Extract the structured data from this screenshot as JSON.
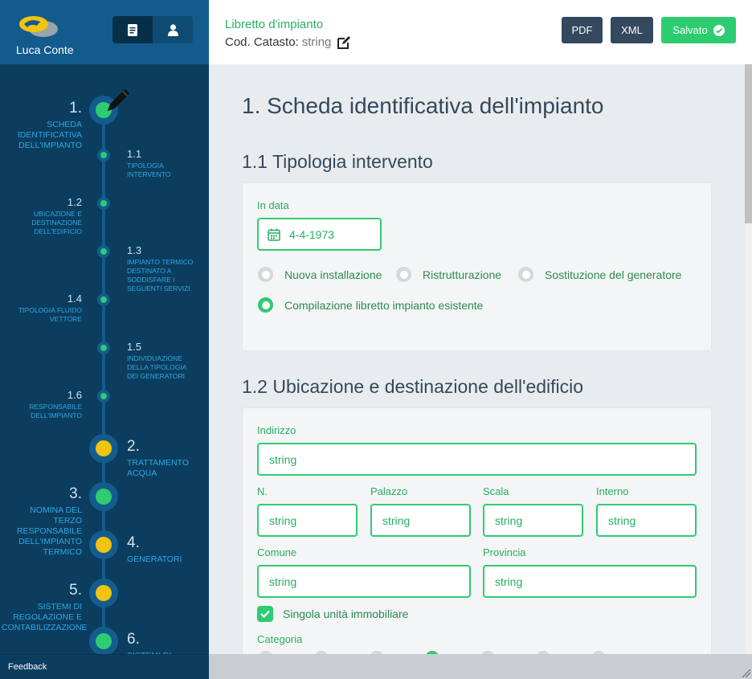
{
  "user": {
    "name": "Luca Conte"
  },
  "topbar": {
    "title": "Libretto d'impianto",
    "cod_label": "Cod. Catasto:",
    "cod_value": "string",
    "pdf_label": "PDF",
    "xml_label": "XML",
    "saved_label": "Salvato"
  },
  "sidebar": {
    "steps": {
      "s1": {
        "num": "1.",
        "label": "Scheda identificativa dell'impianto"
      },
      "s1_1": {
        "num": "1.1",
        "label": "Tipologia intervento"
      },
      "s1_2": {
        "num": "1.2",
        "label": "Ubicazione e destinazione dell'edificio"
      },
      "s1_3": {
        "num": "1.3",
        "label": "Impianto termico destinato a soddisfare i seguenti servizi"
      },
      "s1_4": {
        "num": "1.4",
        "label": "Tipologia fluido vettore"
      },
      "s1_5": {
        "num": "1.5",
        "label": "Individuazione della tipologia dei generatori"
      },
      "s1_6": {
        "num": "1.6",
        "label": "Responsabile dell'impianto"
      },
      "s2": {
        "num": "2.",
        "label": "Trattamento acqua"
      },
      "s3": {
        "num": "3.",
        "label": "Nomina del terzo responsabile dell'impianto termico"
      },
      "s4": {
        "num": "4.",
        "label": "Generatori"
      },
      "s5": {
        "num": "5.",
        "label": "Sistemi di regolazione e contabilizzazione"
      },
      "s6": {
        "num": "6.",
        "label": "Sistemi di"
      }
    },
    "feedback": "Feedback"
  },
  "main": {
    "section_title": "1. Scheda identificativa dell'impianto",
    "tipologia": {
      "title": "1.1 Tipologia intervento",
      "date_label": "In data",
      "date_value": "4-4-1973",
      "options": {
        "nuova": "Nuova installazione",
        "ristrutturazione": "Ristrutturazione",
        "sostituzione": "Sostituzione del generatore",
        "compilazione": "Compilazione libretto impianto esistente"
      },
      "selected": "compilazione"
    },
    "ubicazione": {
      "title": "1.2 Ubicazione e destinazione dell'edificio",
      "indirizzo_label": "Indirizzo",
      "indirizzo_value": "string",
      "n_label": "N.",
      "n_value": "string",
      "palazzo_label": "Palazzo",
      "palazzo_value": "string",
      "scala_label": "Scala",
      "scala_value": "string",
      "interno_label": "Interno",
      "interno_value": "string",
      "comune_label": "Comune",
      "comune_value": "string",
      "provincia_label": "Provincia",
      "provincia_value": "string",
      "singola_label": "Singola unità immobiliare",
      "singola_checked": true,
      "categoria_label": "Categoria"
    }
  },
  "colors": {
    "accent": "#2ecc71",
    "sidebar_bg": "#0b3d5e",
    "sidebar_head": "#135b8d",
    "step_label": "#2fa7e6",
    "pending": "#f1c40f",
    "dark_button": "#34495e"
  }
}
